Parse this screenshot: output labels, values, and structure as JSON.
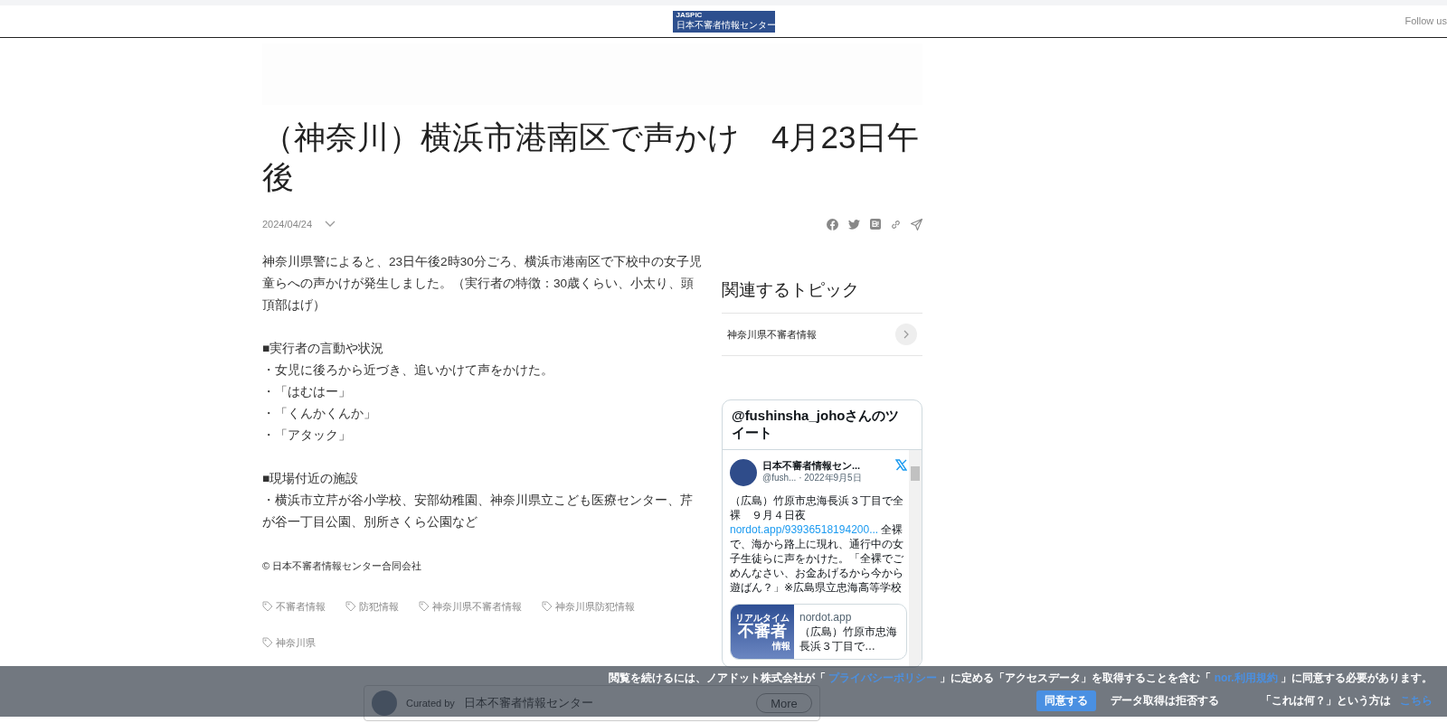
{
  "header": {
    "logo": {
      "small": "JASPIC",
      "main": "日本不審者情報センター"
    },
    "follow": "Follow us"
  },
  "article": {
    "title": "（神奈川）横浜市港南区で声かけ　4月23日午後",
    "date": "2024/04/24",
    "blocks": [
      {
        "kind": "paragraph",
        "text": "神奈川県警によると、23日午後2時30分ごろ、横浜市港南区で下校中の女子児童らへの声かけが発生しました。（実行者の特徴：30歳くらい、小太り、頭頂部はげ）"
      },
      {
        "kind": "section",
        "heading": "■実行者の言動や状況",
        "items": [
          "・女児に後ろから近づき、追いかけて声をかけた。",
          "・「はむはー」",
          "・「くんかくんか」",
          "・「アタック」"
        ]
      },
      {
        "kind": "section",
        "heading": "■現場付近の施設",
        "items": [
          "・横浜市立芹が谷小学校、安部幼稚園、神奈川県立こども医療センター、芹が谷一丁目公園、別所さくら公園など"
        ]
      }
    ],
    "copyright": "© 日本不審者情報センター合同会社",
    "tags": [
      "不審者情報",
      "防犯情報",
      "神奈川県不審者情報",
      "神奈川県防犯情報",
      "神奈川県"
    ],
    "curated": {
      "label": "Curated by",
      "name": "日本不審者情報センター",
      "button": "More"
    }
  },
  "sidebar": {
    "heading": "関連するトピック",
    "topics": [
      {
        "label": "神奈川県不審者情報"
      }
    ],
    "tweets": {
      "title": "@fushinsha_johoさんのツイート",
      "tweet": {
        "author": "日本不審者情報セン...",
        "handle": "@fush...",
        "date": "· 2022年9月5日",
        "text_before": "（広島）竹原市忠海長浜３丁目で全裸　９月４日夜",
        "link": "nordot.app/93936518194200...",
        "text_after": " 全裸で、海から路上に現れ、通行中の女子生徒らに声をかけた。「全裸でごめんなさい、お金あげるから今から遊ばん？」※広島県立忠海高等学校",
        "card": {
          "image_lines": [
            "リアルタイム",
            "不審者",
            "情報"
          ],
          "domain": "nordot.app",
          "title": "（広島）竹原市忠海長浜３丁目で…"
        }
      }
    }
  },
  "consent": {
    "segments": [
      {
        "kind": "text",
        "text": "閲覧を続けるには、ノアドット株式会社が「 "
      },
      {
        "kind": "link",
        "text": "プライバシーポリシー"
      },
      {
        "kind": "text",
        "text": " 」に定める「アクセスデータ」を取得することを含む「 "
      },
      {
        "kind": "link",
        "text": "nor.利用規約"
      },
      {
        "kind": "text",
        "text": " 」に同意する必要があります。"
      }
    ],
    "agree": "同意する",
    "refuse": "データ取得は拒否する",
    "what_text": "「これは何？」という方は ",
    "what_link": "こちら"
  }
}
